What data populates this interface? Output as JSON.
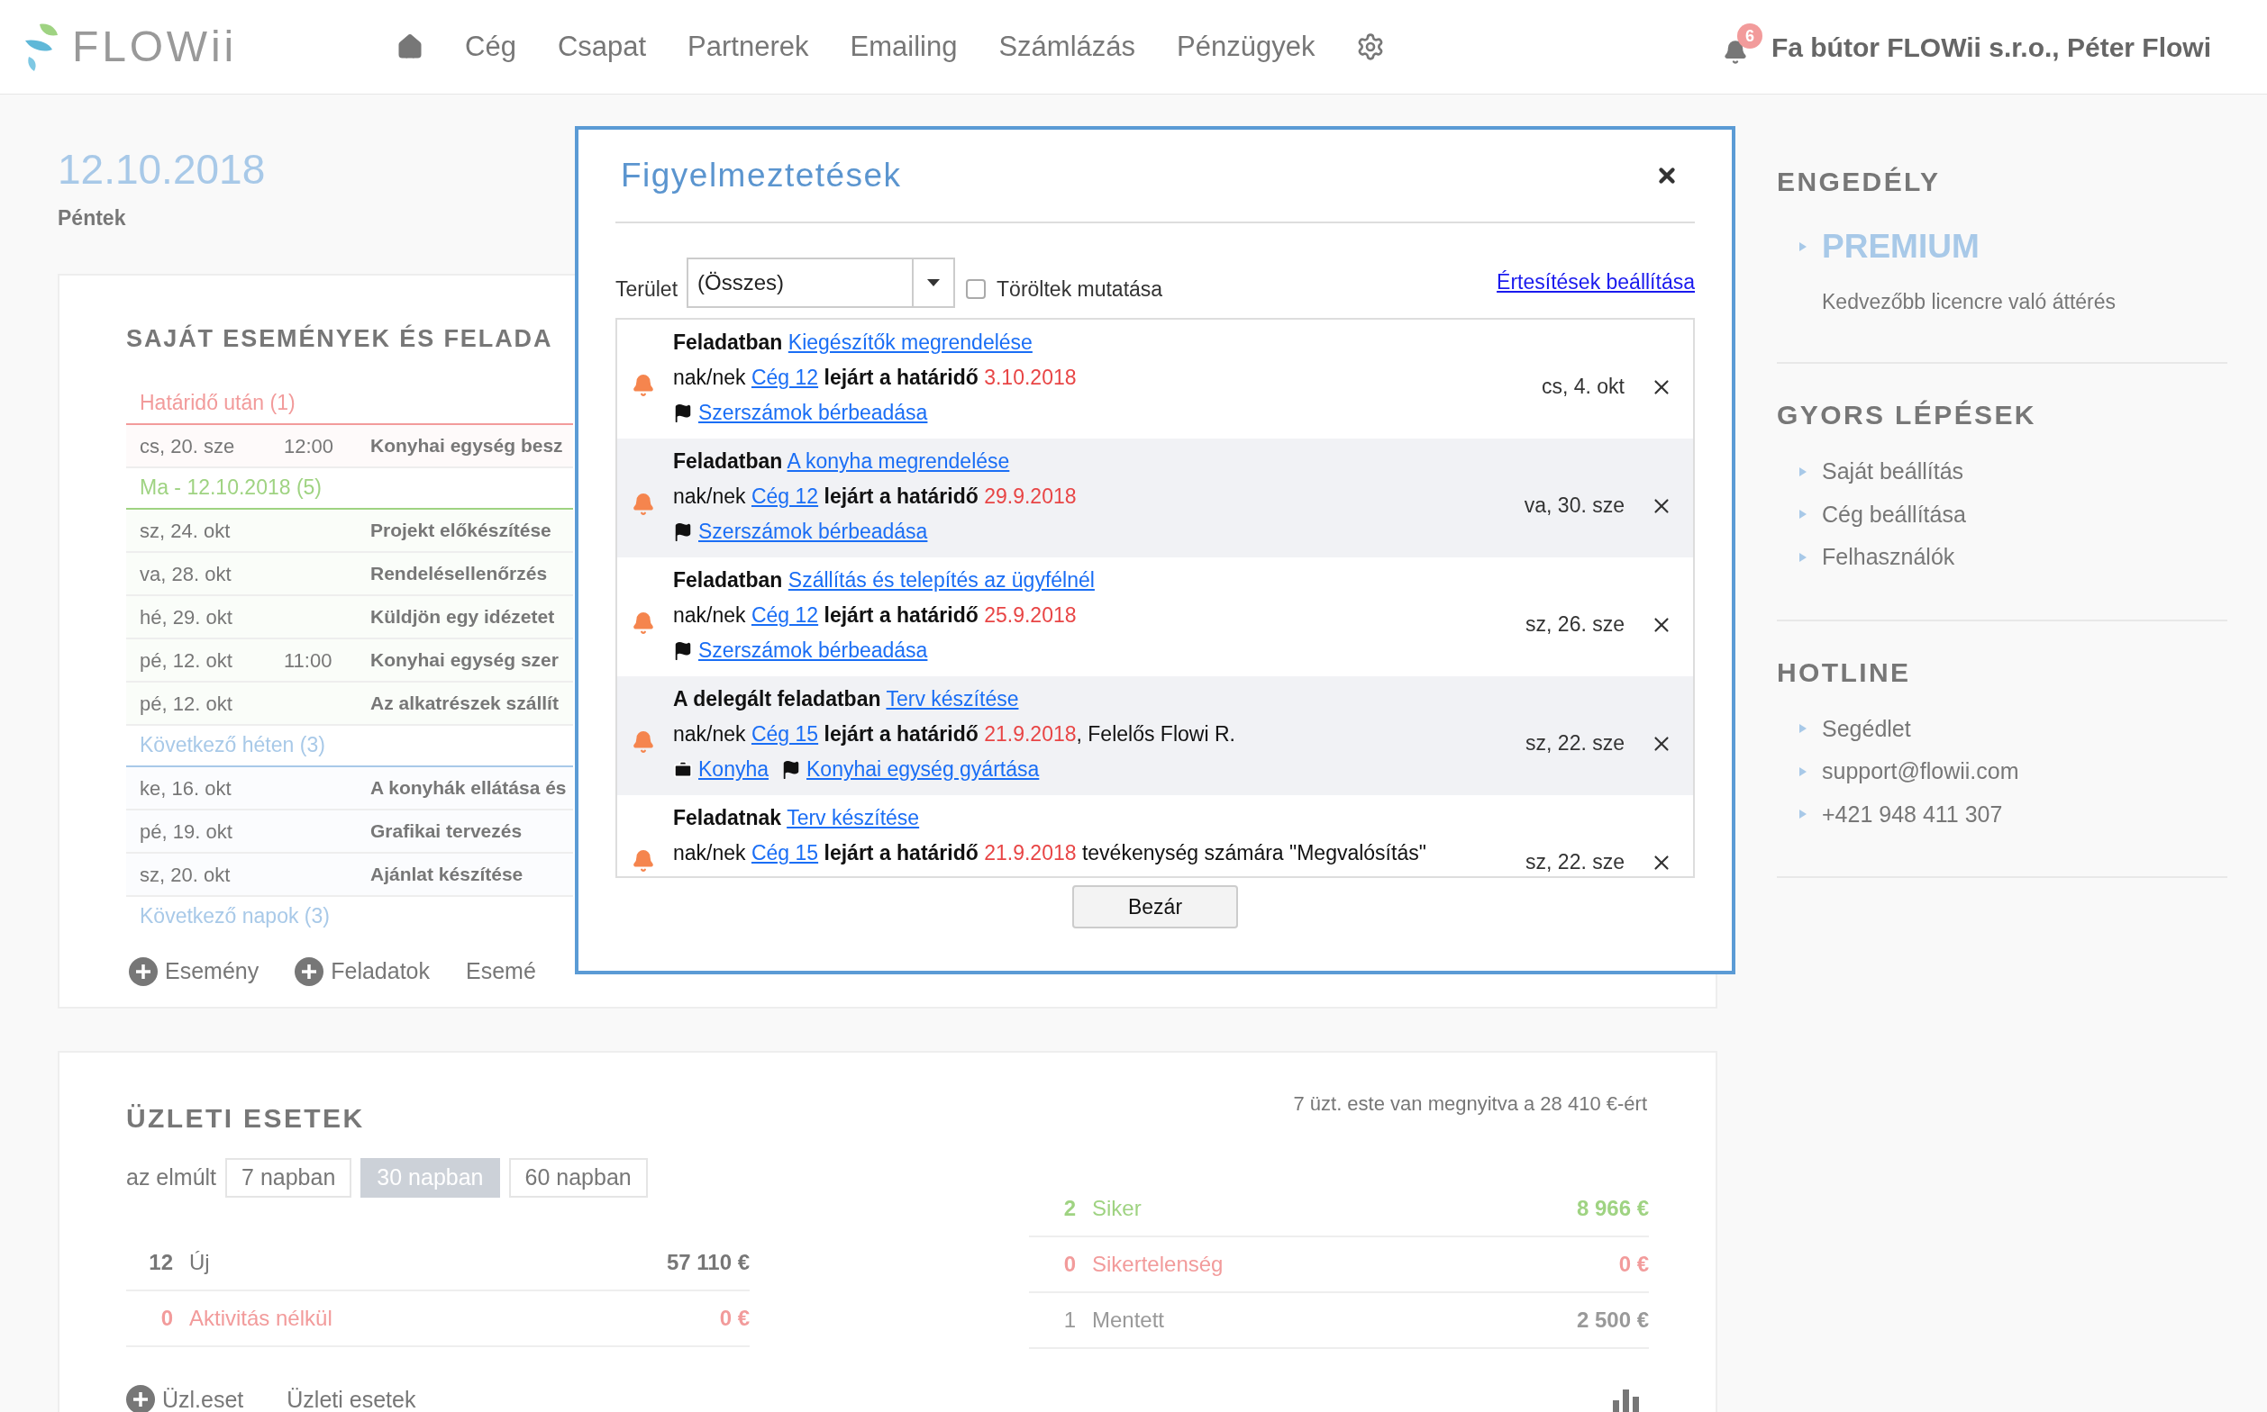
{
  "header": {
    "logo_text": "FLOWii",
    "nav": [
      {
        "label": "Cég"
      },
      {
        "label": "Csapat"
      },
      {
        "label": "Partnerek"
      },
      {
        "label": "Emailing"
      },
      {
        "label": "Számlázás"
      },
      {
        "label": "Pénzügyek"
      }
    ],
    "notification_count": "6",
    "user": "Fa bútor FLOWii s.r.o., Péter Flowi"
  },
  "date": {
    "value": "12.10.2018",
    "weekday": "Péntek"
  },
  "events": {
    "title": "SAJÁT ESEMÉNYEK ÉS FELADA",
    "groups": [
      {
        "label": "Határidő után (1)",
        "color": "#f29b9b",
        "rows": [
          {
            "date": "cs, 20. sze",
            "time": "12:00",
            "title": "Konyhai egység besz"
          }
        ]
      },
      {
        "label": "Ma - 12.10.2018 (5)",
        "color": "#9fd382",
        "rows": [
          {
            "date": "sz, 24. okt",
            "title": "Projekt előkészítése"
          },
          {
            "date": "va, 28. okt",
            "title": "Rendelésellenőrzés"
          },
          {
            "date": "hé, 29. okt",
            "title": "Küldjön egy idézetet"
          },
          {
            "date": "pé, 12. okt",
            "time": "11:00",
            "title": "Konyhai egység szer"
          },
          {
            "date": "pé, 12. okt",
            "title": "Az alkatrészek szállít"
          }
        ]
      },
      {
        "label": "Következő héten (3)",
        "color": "#a8c9e8",
        "rows": [
          {
            "date": "ke, 16. okt",
            "title": "A konyhák ellátása és"
          },
          {
            "date": "pé, 19. okt",
            "title": "Grafikai tervezés"
          },
          {
            "date": "sz, 20. okt",
            "title": "Ajánlat készítése"
          }
        ]
      },
      {
        "label": "Következő napok (3)",
        "color": "#a8c9e8"
      }
    ],
    "actions": [
      {
        "label": "Esemény",
        "kind": "add"
      },
      {
        "label": "Feladatok",
        "kind": "add"
      },
      {
        "label": "Esemé",
        "kind": "link"
      }
    ]
  },
  "business": {
    "title": "ÜZLETI ESETEK",
    "summary": "7 üzt. este van megnyitva a 28 410 €-ért",
    "filter": {
      "label": "az elmúlt",
      "options": [
        {
          "label": "7 napban",
          "selected": false
        },
        {
          "label": "30 napban",
          "selected": true
        },
        {
          "label": "60 napban",
          "selected": false
        }
      ]
    },
    "left_stats": [
      {
        "count": "12",
        "label": "Új",
        "amount": "57 110 €",
        "kind": "total"
      },
      {
        "count": "0",
        "label": "Aktivitás nélkül",
        "amount": "0 €",
        "kind": "danger"
      }
    ],
    "right_stats": [
      {
        "count": "2",
        "label": "Siker",
        "amount": "8 966 €",
        "kind": "success"
      },
      {
        "count": "0",
        "label": "Sikertelenség",
        "amount": "0 €",
        "kind": "danger"
      },
      {
        "count": "1",
        "label": "Mentett",
        "amount": "2 500 €",
        "kind": "neutral"
      }
    ],
    "actions": [
      {
        "label": "Üzl.eset",
        "kind": "add"
      },
      {
        "label": "Üzleti esetek",
        "kind": "link"
      }
    ]
  },
  "sidebar": [
    {
      "title": "ENGEDÉLY",
      "items": [
        {
          "label": "PREMIUM",
          "kind": "highlight"
        },
        {
          "label": "Kedvezőbb licencre való áttérés",
          "kind": "note"
        }
      ]
    },
    {
      "title": "GYORS LÉPÉSEK",
      "items": [
        {
          "label": "Saját beállítás",
          "kind": "link"
        },
        {
          "label": "Cég beállítása",
          "kind": "link"
        },
        {
          "label": "Felhasználók",
          "kind": "link"
        }
      ]
    },
    {
      "title": "HOTLINE",
      "items": [
        {
          "label": "Segédlet",
          "kind": "link"
        },
        {
          "label": "support@flowii.com",
          "kind": "link"
        },
        {
          "label": "+421 948 411 307",
          "kind": "link"
        }
      ]
    }
  ],
  "modal": {
    "title": "Figyelmeztetések",
    "filter_label": "Terület",
    "select_value": "(Összes)",
    "checkbox": {
      "label": "Töröltek mutatása",
      "checked": false
    },
    "settings_link": "Értesítések beállítása",
    "close_button": "Bezár",
    "notifications": [
      {
        "date": "cs, 4. okt",
        "lines": [
          [
            {
              "kind": "bold",
              "text": "Feladatban"
            },
            {
              "kind": "link",
              "text": "Kiegészítők megrendelése"
            }
          ],
          [
            {
              "kind": "text",
              "text": "nak/nek"
            },
            {
              "kind": "link",
              "text": "Cég 12"
            },
            {
              "kind": "bold",
              "text": "lejárt a határidő"
            },
            {
              "kind": "red",
              "text": "3.10.2018"
            }
          ]
        ],
        "tags": [
          {
            "kind": "activity",
            "label": "Szerszámok bérbeadása"
          }
        ]
      },
      {
        "date": "va, 30. sze",
        "lines": [
          [
            {
              "kind": "bold",
              "text": "Feladatban"
            },
            {
              "kind": "link",
              "text": "A konyha megrendelése"
            }
          ],
          [
            {
              "kind": "text",
              "text": "nak/nek"
            },
            {
              "kind": "link",
              "text": "Cég 12"
            },
            {
              "kind": "bold",
              "text": "lejárt a határidő"
            },
            {
              "kind": "red",
              "text": "29.9.2018"
            }
          ]
        ],
        "tags": [
          {
            "kind": "activity",
            "label": "Szerszámok bérbeadása"
          }
        ]
      },
      {
        "date": "sz, 26. sze",
        "lines": [
          [
            {
              "kind": "bold",
              "text": "Feladatban"
            },
            {
              "kind": "link",
              "text": "Szállítás és telepítés az ügyfélnél"
            }
          ],
          [
            {
              "kind": "text",
              "text": "nak/nek"
            },
            {
              "kind": "link",
              "text": "Cég 12"
            },
            {
              "kind": "bold",
              "text": "lejárt a határidő"
            },
            {
              "kind": "red",
              "text": "25.9.2018"
            }
          ]
        ],
        "tags": [
          {
            "kind": "activity",
            "label": "Szerszámok bérbeadása"
          }
        ]
      },
      {
        "date": "sz, 22. sze",
        "lines": [
          [
            {
              "kind": "bold",
              "text": "A delegált feladatban"
            },
            {
              "kind": "link",
              "text": "Terv készítése"
            }
          ],
          [
            {
              "kind": "text",
              "text": "nak/nek"
            },
            {
              "kind": "link",
              "text": "Cég 15"
            },
            {
              "kind": "bold",
              "text": "lejárt a határidő"
            },
            {
              "kind": "red",
              "text": "21.9.2018"
            },
            {
              "kind": "text",
              "text": ", Felelős Flowi R.",
              "attach": true
            }
          ]
        ],
        "tags": [
          {
            "kind": "project",
            "label": "Konyha"
          },
          {
            "kind": "activity",
            "label": "Konyhai egység gyártása"
          }
        ]
      },
      {
        "date": "sz, 22. sze",
        "lines": [
          [
            {
              "kind": "bold",
              "text": "Feladatnak"
            },
            {
              "kind": "link",
              "text": "Terv készítése"
            }
          ],
          [
            {
              "kind": "text",
              "text": "nak/nek"
            },
            {
              "kind": "link",
              "text": "Cég 15"
            },
            {
              "kind": "bold",
              "text": "lejárt a határidő"
            },
            {
              "kind": "red",
              "text": "21.9.2018"
            },
            {
              "kind": "text",
              "text": "tevékenység számára \"Megvalósítás\""
            }
          ]
        ]
      }
    ]
  }
}
